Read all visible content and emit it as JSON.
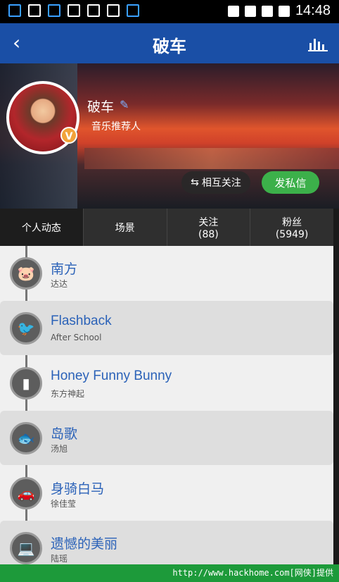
{
  "status": {
    "time": "14:48"
  },
  "header": {
    "back_icon": "‹",
    "title": "破车",
    "stats_icon": "bar-chart-icon"
  },
  "profile": {
    "name": "破车",
    "role": "音乐推荐人",
    "badge": "V",
    "follow_button": "相互关注",
    "message_button": "发私信"
  },
  "tabs": [
    {
      "label": "个人动态",
      "sub": ""
    },
    {
      "label": "场景",
      "sub": ""
    },
    {
      "label": "关注",
      "sub": "(88)"
    },
    {
      "label": "粉丝",
      "sub": "(5949)"
    }
  ],
  "songs": [
    {
      "title": "南方",
      "artist": "达达",
      "icon": "pig-icon"
    },
    {
      "title": "Flashback",
      "artist": "After School",
      "icon": "bird-icon"
    },
    {
      "title": "Honey Funny Bunny",
      "artist": "东方神起",
      "icon": "bottle-icon"
    },
    {
      "title": "岛歌",
      "artist": "汤旭",
      "icon": "fish-icon"
    },
    {
      "title": "身骑白马",
      "artist": "徐佳莹",
      "icon": "car-icon"
    },
    {
      "title": "遗憾的美丽",
      "artist": "陆瑶",
      "icon": "laptop-icon"
    }
  ],
  "footer": {
    "text": "http://www.hackhome.com[网侠]提供"
  }
}
